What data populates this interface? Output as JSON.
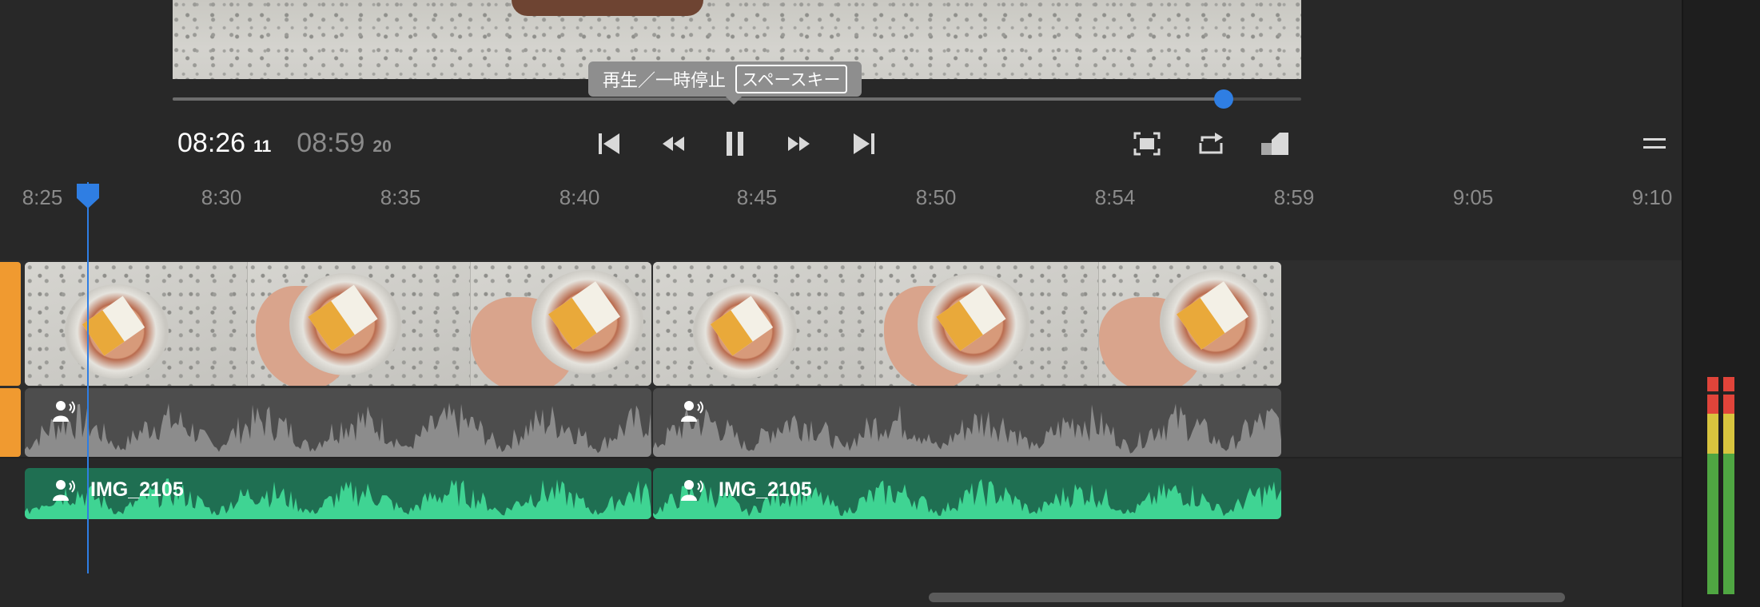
{
  "tooltip": {
    "label": "再生／一時停止",
    "key": "スペースキー"
  },
  "timecode": {
    "current_time": "08:26",
    "current_frames": "11",
    "duration_time": "08:59",
    "duration_frames": "20"
  },
  "playback": {
    "position_fraction": 0.93
  },
  "transport": {
    "icons": [
      "skip-to-start-icon",
      "rewind-icon",
      "pause-icon",
      "fast-forward-icon",
      "skip-to-end-icon"
    ],
    "right_icons": [
      "fit-to-screen-icon",
      "loop-icon",
      "picture-in-picture-icon",
      "menu-icon"
    ]
  },
  "ruler": {
    "ticks": [
      "8:25",
      "8:30",
      "8:35",
      "8:40",
      "8:45",
      "8:50",
      "8:54",
      "8:59",
      "9:05",
      "9:10"
    ]
  },
  "clips": [
    {
      "name": "IMG_2105"
    },
    {
      "name": "IMG_2105"
    }
  ],
  "colors": {
    "accent": "#2f7ee3",
    "clip_green": "#1f6f52",
    "waveform_green": "#3fd493",
    "track_orange": "#f09a30",
    "meter_green": "#4fa642",
    "meter_yellow": "#d8c43e",
    "meter_red": "#e0443a"
  }
}
